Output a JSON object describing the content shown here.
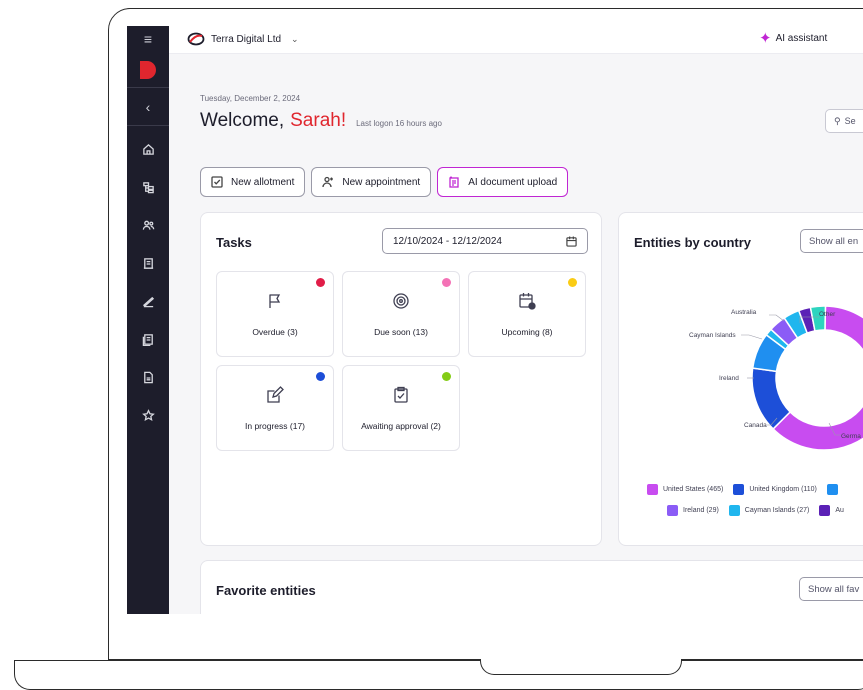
{
  "topbar": {
    "org_name": "Terra Digital Ltd",
    "ai_assistant_label": "AI assistant"
  },
  "sidebar": {
    "items": [
      {
        "icon": "home-icon"
      },
      {
        "icon": "structure-icon"
      },
      {
        "icon": "people-icon"
      },
      {
        "icon": "ledger-icon"
      },
      {
        "icon": "signature-icon"
      },
      {
        "icon": "documents-icon"
      },
      {
        "icon": "file-icon"
      },
      {
        "icon": "star-icon"
      }
    ]
  },
  "header": {
    "date": "Tuesday, December 2, 2024",
    "welcome": "Welcome,",
    "user_name": "Sarah!",
    "last_logon": "Last logon 16 hours ago",
    "search_label": "Se"
  },
  "actions": {
    "new_allotment": "New allotment",
    "new_appointment": "New appointment",
    "ai_document_upload": "AI document upload"
  },
  "tasks": {
    "title": "Tasks",
    "date_range": "12/10/2024 - 12/12/2024",
    "tiles": [
      {
        "label": "Overdue (3)",
        "icon": "flag-icon",
        "dot_color": "#e11d48"
      },
      {
        "label": "Due soon (13)",
        "icon": "target-icon",
        "dot_color": "#f472b6"
      },
      {
        "label": "Upcoming (8)",
        "icon": "calendar-clock-icon",
        "dot_color": "#facc15"
      },
      {
        "label": "In progress (17)",
        "icon": "edit-icon",
        "dot_color": "#1d4ed8"
      },
      {
        "label": "Awaiting approval (2)",
        "icon": "clipboard-check-icon",
        "dot_color": "#84cc16"
      }
    ]
  },
  "entities": {
    "title": "Entities by country",
    "show_all_label": "Show all en",
    "chart_labels": {
      "australia": "Australia",
      "other": "Other",
      "cayman": "Cayman Islands",
      "ireland": "Ireland",
      "canada": "Canada",
      "germany": "Germa"
    },
    "legend": [
      {
        "label": "United States (465)",
        "color": "#c84cf0"
      },
      {
        "label": "United Kingdom (110)",
        "color": "#1d4fd8"
      },
      {
        "label": "",
        "color": "#1f8ff0"
      },
      {
        "label": "Ireland (29)",
        "color": "#8b5cf6"
      },
      {
        "label": "Cayman Islands (27)",
        "color": "#20b6ee"
      },
      {
        "label": "Au",
        "color": "#5b21b6"
      }
    ]
  },
  "chart_data": {
    "type": "pie",
    "categories": [
      "United States",
      "United Kingdom",
      "Germany",
      "Canada",
      "Ireland",
      "Cayman Islands",
      "Australia",
      "Other"
    ],
    "values": [
      465,
      110,
      60,
      12,
      29,
      27,
      20,
      25
    ],
    "colors": [
      "#c84cf0",
      "#1d4fd8",
      "#1f8ff0",
      "#20b6ee",
      "#8b5cf6",
      "#20b6ee",
      "#5b21b6",
      "#2dd4bf"
    ]
  },
  "favorites": {
    "title": "Favorite entities",
    "show_all_label": "Show all fav"
  }
}
